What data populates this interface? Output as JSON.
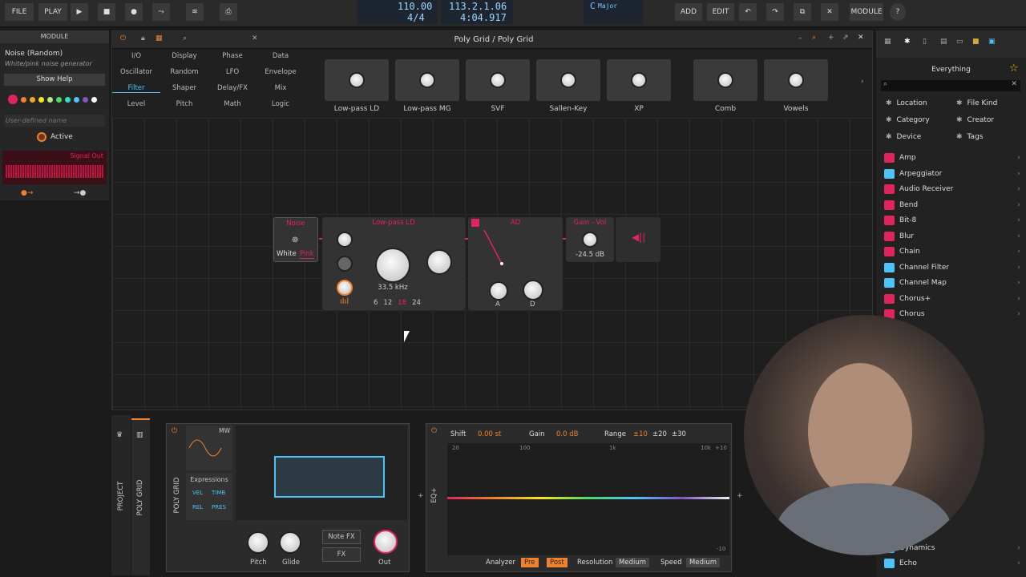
{
  "topbar": {
    "file": "FILE",
    "play": "PLAY",
    "tempo": "110.00",
    "timesig": "4/4",
    "position": "113.2.1.06",
    "time": "4:04.917",
    "key": "C",
    "scale": "Major",
    "add": "ADD",
    "edit": "EDIT",
    "module": "MODULE",
    "help": "?"
  },
  "inspector": {
    "title": "MODULE",
    "module_name": "Noise (Random)",
    "module_desc": "White/pink noise generator",
    "show_help": "Show Help",
    "user_name_placeholder": "User-defined name",
    "active": "Active",
    "signal_out": "Signal Out"
  },
  "editor": {
    "title": "Poly Grid / Poly Grid",
    "categories": [
      "I/O",
      "Display",
      "Phase",
      "Data",
      "Oscillator",
      "Random",
      "LFO",
      "Envelope",
      "Filter",
      "Shaper",
      "Delay/FX",
      "Mix",
      "Level",
      "Pitch",
      "Math",
      "Logic"
    ],
    "active_category": "Filter",
    "thumbs": [
      "Low-pass LD",
      "Low-pass MG",
      "SVF",
      "Sallen-Key",
      "XP",
      "Comb",
      "Vowels"
    ]
  },
  "modules": {
    "noise": {
      "title": "Noise",
      "white": "White",
      "pink": "Pink"
    },
    "lowpass": {
      "title": "Low-pass LD",
      "freq": "33.5 kHz",
      "slopes": [
        "6",
        "12",
        "18",
        "24"
      ]
    },
    "ad": {
      "title": "AD",
      "a": "A",
      "d": "D"
    },
    "gain": {
      "title": "Gain - Vol",
      "value": "-24.5 dB"
    }
  },
  "browser": {
    "title": "Everything",
    "search_placeholder": "",
    "filters": [
      "Location",
      "File Kind",
      "Category",
      "Creator",
      "Device",
      "Tags"
    ],
    "items": [
      "Amp",
      "Arpeggiator",
      "Audio Receiver",
      "Bend",
      "Bit-8",
      "Blur",
      "Chain",
      "Channel Filter",
      "Channel Map",
      "Chorus+",
      "Chorus"
    ],
    "bottom_items": [
      "Dynamics",
      "Echo"
    ]
  },
  "bottom": {
    "project": "PROJECT",
    "poly_grid_tab": "POLY GRID",
    "poly_grid_label": "POLY GRID",
    "mw": "MW",
    "expressions": "Expressions",
    "expr": [
      "VEL",
      "TIMB",
      "REL",
      "PRES"
    ],
    "pitch": "Pitch",
    "glide": "Glide",
    "note_fx": "Note FX",
    "fx": "FX",
    "out": "Out",
    "eq_label": "EQ+",
    "shift": "Shift",
    "shift_val": "0.00 st",
    "gain": "Gain",
    "gain_val": "0.0 dB",
    "range": "Range",
    "ranges": [
      "±10",
      "±20",
      "±30"
    ],
    "freqs": [
      "20",
      "100",
      "1k",
      "10k"
    ],
    "db_top": "+10",
    "db_bottom": "-10",
    "analyzer": "Analyzer",
    "pre": "Pre",
    "post": "Post",
    "resolution": "Resolution",
    "res_val": "Medium",
    "speed": "Speed",
    "speed_val": "Medium"
  },
  "colors": {
    "accent": "#e0245e",
    "orange": "#f0822d",
    "blue": "#4fc3f7"
  }
}
